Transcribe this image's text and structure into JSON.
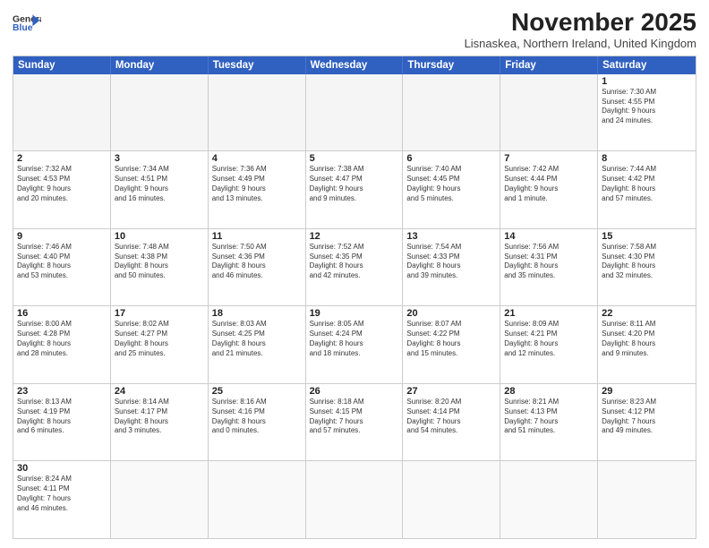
{
  "header": {
    "logo_line1": "General",
    "logo_line2": "Blue",
    "month_title": "November 2025",
    "subtitle": "Lisnaskea, Northern Ireland, United Kingdom"
  },
  "day_headers": [
    "Sunday",
    "Monday",
    "Tuesday",
    "Wednesday",
    "Thursday",
    "Friday",
    "Saturday"
  ],
  "weeks": [
    [
      {
        "day": "",
        "info": ""
      },
      {
        "day": "",
        "info": ""
      },
      {
        "day": "",
        "info": ""
      },
      {
        "day": "",
        "info": ""
      },
      {
        "day": "",
        "info": ""
      },
      {
        "day": "",
        "info": ""
      },
      {
        "day": "1",
        "info": "Sunrise: 7:30 AM\nSunset: 4:55 PM\nDaylight: 9 hours\nand 24 minutes."
      }
    ],
    [
      {
        "day": "2",
        "info": "Sunrise: 7:32 AM\nSunset: 4:53 PM\nDaylight: 9 hours\nand 20 minutes."
      },
      {
        "day": "3",
        "info": "Sunrise: 7:34 AM\nSunset: 4:51 PM\nDaylight: 9 hours\nand 16 minutes."
      },
      {
        "day": "4",
        "info": "Sunrise: 7:36 AM\nSunset: 4:49 PM\nDaylight: 9 hours\nand 13 minutes."
      },
      {
        "day": "5",
        "info": "Sunrise: 7:38 AM\nSunset: 4:47 PM\nDaylight: 9 hours\nand 9 minutes."
      },
      {
        "day": "6",
        "info": "Sunrise: 7:40 AM\nSunset: 4:45 PM\nDaylight: 9 hours\nand 5 minutes."
      },
      {
        "day": "7",
        "info": "Sunrise: 7:42 AM\nSunset: 4:44 PM\nDaylight: 9 hours\nand 1 minute."
      },
      {
        "day": "8",
        "info": "Sunrise: 7:44 AM\nSunset: 4:42 PM\nDaylight: 8 hours\nand 57 minutes."
      }
    ],
    [
      {
        "day": "9",
        "info": "Sunrise: 7:46 AM\nSunset: 4:40 PM\nDaylight: 8 hours\nand 53 minutes."
      },
      {
        "day": "10",
        "info": "Sunrise: 7:48 AM\nSunset: 4:38 PM\nDaylight: 8 hours\nand 50 minutes."
      },
      {
        "day": "11",
        "info": "Sunrise: 7:50 AM\nSunset: 4:36 PM\nDaylight: 8 hours\nand 46 minutes."
      },
      {
        "day": "12",
        "info": "Sunrise: 7:52 AM\nSunset: 4:35 PM\nDaylight: 8 hours\nand 42 minutes."
      },
      {
        "day": "13",
        "info": "Sunrise: 7:54 AM\nSunset: 4:33 PM\nDaylight: 8 hours\nand 39 minutes."
      },
      {
        "day": "14",
        "info": "Sunrise: 7:56 AM\nSunset: 4:31 PM\nDaylight: 8 hours\nand 35 minutes."
      },
      {
        "day": "15",
        "info": "Sunrise: 7:58 AM\nSunset: 4:30 PM\nDaylight: 8 hours\nand 32 minutes."
      }
    ],
    [
      {
        "day": "16",
        "info": "Sunrise: 8:00 AM\nSunset: 4:28 PM\nDaylight: 8 hours\nand 28 minutes."
      },
      {
        "day": "17",
        "info": "Sunrise: 8:02 AM\nSunset: 4:27 PM\nDaylight: 8 hours\nand 25 minutes."
      },
      {
        "day": "18",
        "info": "Sunrise: 8:03 AM\nSunset: 4:25 PM\nDaylight: 8 hours\nand 21 minutes."
      },
      {
        "day": "19",
        "info": "Sunrise: 8:05 AM\nSunset: 4:24 PM\nDaylight: 8 hours\nand 18 minutes."
      },
      {
        "day": "20",
        "info": "Sunrise: 8:07 AM\nSunset: 4:22 PM\nDaylight: 8 hours\nand 15 minutes."
      },
      {
        "day": "21",
        "info": "Sunrise: 8:09 AM\nSunset: 4:21 PM\nDaylight: 8 hours\nand 12 minutes."
      },
      {
        "day": "22",
        "info": "Sunrise: 8:11 AM\nSunset: 4:20 PM\nDaylight: 8 hours\nand 9 minutes."
      }
    ],
    [
      {
        "day": "23",
        "info": "Sunrise: 8:13 AM\nSunset: 4:19 PM\nDaylight: 8 hours\nand 6 minutes."
      },
      {
        "day": "24",
        "info": "Sunrise: 8:14 AM\nSunset: 4:17 PM\nDaylight: 8 hours\nand 3 minutes."
      },
      {
        "day": "25",
        "info": "Sunrise: 8:16 AM\nSunset: 4:16 PM\nDaylight: 8 hours\nand 0 minutes."
      },
      {
        "day": "26",
        "info": "Sunrise: 8:18 AM\nSunset: 4:15 PM\nDaylight: 7 hours\nand 57 minutes."
      },
      {
        "day": "27",
        "info": "Sunrise: 8:20 AM\nSunset: 4:14 PM\nDaylight: 7 hours\nand 54 minutes."
      },
      {
        "day": "28",
        "info": "Sunrise: 8:21 AM\nSunset: 4:13 PM\nDaylight: 7 hours\nand 51 minutes."
      },
      {
        "day": "29",
        "info": "Sunrise: 8:23 AM\nSunset: 4:12 PM\nDaylight: 7 hours\nand 49 minutes."
      }
    ],
    [
      {
        "day": "30",
        "info": "Sunrise: 8:24 AM\nSunset: 4:11 PM\nDaylight: 7 hours\nand 46 minutes."
      },
      {
        "day": "",
        "info": ""
      },
      {
        "day": "",
        "info": ""
      },
      {
        "day": "",
        "info": ""
      },
      {
        "day": "",
        "info": ""
      },
      {
        "day": "",
        "info": ""
      },
      {
        "day": "",
        "info": ""
      }
    ]
  ]
}
